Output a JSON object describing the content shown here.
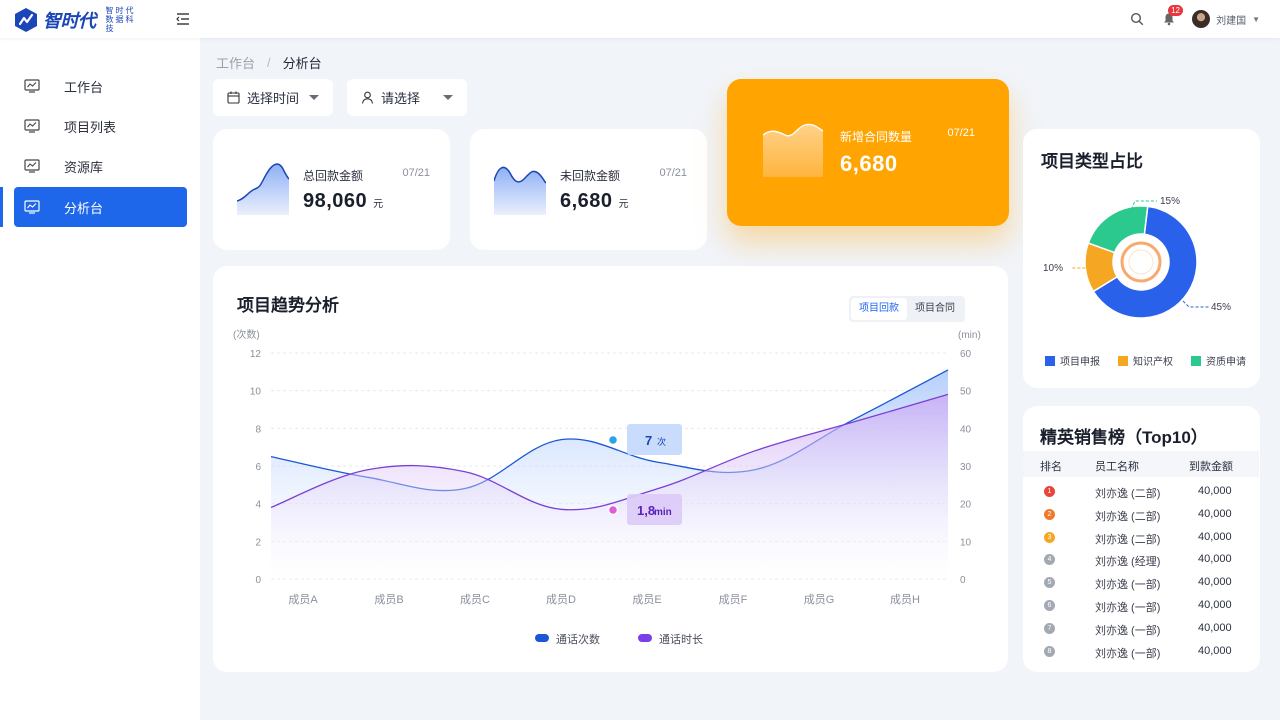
{
  "app": {
    "logo_text": "智时代",
    "logo_sub": "智时代数据科技"
  },
  "header": {
    "notification_count": "12",
    "user_name": "刘建国"
  },
  "sidebar": {
    "items": [
      {
        "label": "工作台",
        "active": false
      },
      {
        "label": "项目列表",
        "active": false
      },
      {
        "label": "资源库",
        "active": false
      },
      {
        "label": "分析台",
        "active": true
      }
    ]
  },
  "breadcrumb": {
    "parent": "工作台",
    "separator": "/",
    "current": "分析台"
  },
  "filters": {
    "time_label": "选择时间",
    "person_label": "请选择"
  },
  "stats": {
    "total": {
      "label": "总回款金额",
      "date": "07/21",
      "value": "98,060",
      "unit": "元"
    },
    "unpaid": {
      "label": "未回款金额",
      "date": "07/21",
      "value": "6,680",
      "unit": "元"
    },
    "contracts": {
      "label": "新增合同数量",
      "date": "07/21",
      "value": "6,680"
    }
  },
  "trend": {
    "title": "项目趋势分析",
    "tabs": [
      "项目回款",
      "项目合同"
    ],
    "active_tab": 0
  },
  "chart_data": [
    {
      "type": "area",
      "title": "项目趋势分析",
      "categories": [
        "成员A",
        "成员B",
        "成员C",
        "成员D",
        "成员E",
        "成员F",
        "成员G",
        "成员H"
      ],
      "y_left": {
        "label": "(次数)",
        "ticks": [
          0,
          2,
          4,
          6,
          8,
          10,
          12
        ],
        "range": [
          0,
          12
        ]
      },
      "y_right": {
        "label": "(min)",
        "ticks": [
          0,
          10,
          20,
          30,
          40,
          50,
          60
        ],
        "range": [
          0,
          60
        ]
      },
      "series": [
        {
          "name": "通话次数",
          "axis": "left",
          "color": "#1b57d6",
          "values": [
            6.5,
            5.4,
            4.8,
            7.4,
            6.2,
            5.8,
            8.4,
            11.1
          ]
        },
        {
          "name": "通话时长",
          "axis": "right",
          "color": "#7a3fd6",
          "values": [
            19,
            29,
            28.5,
            18.5,
            24,
            34,
            41.5,
            49
          ]
        }
      ],
      "annotations": [
        {
          "series": "通话次数",
          "category": "成员E",
          "value": "7",
          "unit": "次"
        },
        {
          "series": "通话时长",
          "category": "成员E",
          "value": "1,8",
          "unit": "min"
        }
      ],
      "legend_position": "bottom",
      "grid": true
    },
    {
      "type": "pie",
      "title": "项目类型占比",
      "categories": [
        "项目申报",
        "知识产权",
        "资质申请"
      ],
      "values": [
        45,
        10,
        15
      ],
      "labels": [
        "45%",
        "10%",
        "15%"
      ],
      "colors": [
        "#2a61ea",
        "#f5a623",
        "#2cc98f"
      ],
      "legend_position": "bottom"
    }
  ],
  "pie": {
    "title": "项目类型占比",
    "legend": [
      {
        "name": "项目申报",
        "color": "#2a61ea"
      },
      {
        "name": "知识产权",
        "color": "#f5a623"
      },
      {
        "name": "资质申请",
        "color": "#2cc98f"
      }
    ]
  },
  "ranking": {
    "title": "精英销售榜（Top10）",
    "headers": {
      "rank": "排名",
      "name": "员工名称",
      "amount": "到款金额"
    },
    "rows": [
      {
        "rank": "1",
        "name": "刘亦逸 (二部)",
        "amount": "40,000"
      },
      {
        "rank": "2",
        "name": "刘亦逸 (二部)",
        "amount": "40,000"
      },
      {
        "rank": "3",
        "name": "刘亦逸 (二部)",
        "amount": "40,000"
      },
      {
        "rank": "4",
        "name": "刘亦逸 (经理)",
        "amount": "40,000"
      },
      {
        "rank": "5",
        "name": "刘亦逸 (一部)",
        "amount": "40,000"
      },
      {
        "rank": "6",
        "name": "刘亦逸 (一部)",
        "amount": "40,000"
      },
      {
        "rank": "7",
        "name": "刘亦逸 (一部)",
        "amount": "40,000"
      },
      {
        "rank": "8",
        "name": "刘亦逸 (一部)",
        "amount": "40,000"
      }
    ],
    "rank_colors": [
      "#e8453c",
      "#f07a2a",
      "#f5a623",
      "#a3a9b3",
      "#a3a9b3",
      "#a3a9b3",
      "#a3a9b3",
      "#a3a9b3"
    ]
  }
}
